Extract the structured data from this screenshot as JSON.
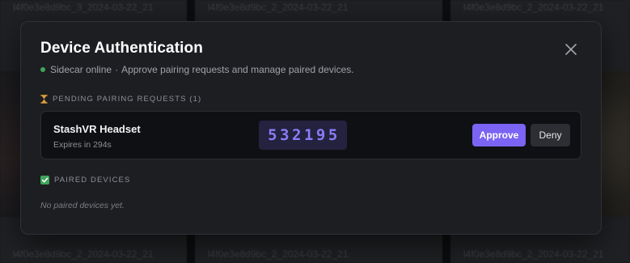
{
  "background": {
    "tiles_top": [
      "l4f0e3e8d9bc_3_2024-03-22_21",
      "l4f0e3e8d9bc_2_2024-03-22_21",
      "l4f0e3e8d9bc_2_2024-03-22_21"
    ],
    "tiles_bottom": [
      "l4f0e3e8d9bc_2_2024-03-22_21",
      "l4f0e3e8d9bc_2_2024-03-22_21",
      "l4f0e3e8d9bc_2_2024-03-22_21"
    ]
  },
  "modal": {
    "title": "Device Authentication",
    "close_icon": "close-x",
    "status": {
      "online_label": "Sidecar online",
      "separator": "·",
      "description": "Approve pairing requests and manage paired devices.",
      "dot_color": "#3fa55a"
    },
    "pending": {
      "icon": "hourglass",
      "header": "Pending pairing requests (1)",
      "requests": [
        {
          "device_name": "StashVR Headset",
          "expires": "Expires in 294s",
          "code": "532195",
          "approve_label": "Approve",
          "deny_label": "Deny"
        }
      ]
    },
    "paired": {
      "icon": "check-box",
      "header": "Paired devices",
      "empty_text": "No paired devices yet."
    }
  },
  "colors": {
    "accent": "#7b63f3",
    "code_text": "#8a7cf6",
    "code_bg": "#24223f",
    "modal_bg": "#1d1e22",
    "card_bg": "#0f1013",
    "check_green": "#3fa55a",
    "hourglass": "#e0a33a"
  }
}
